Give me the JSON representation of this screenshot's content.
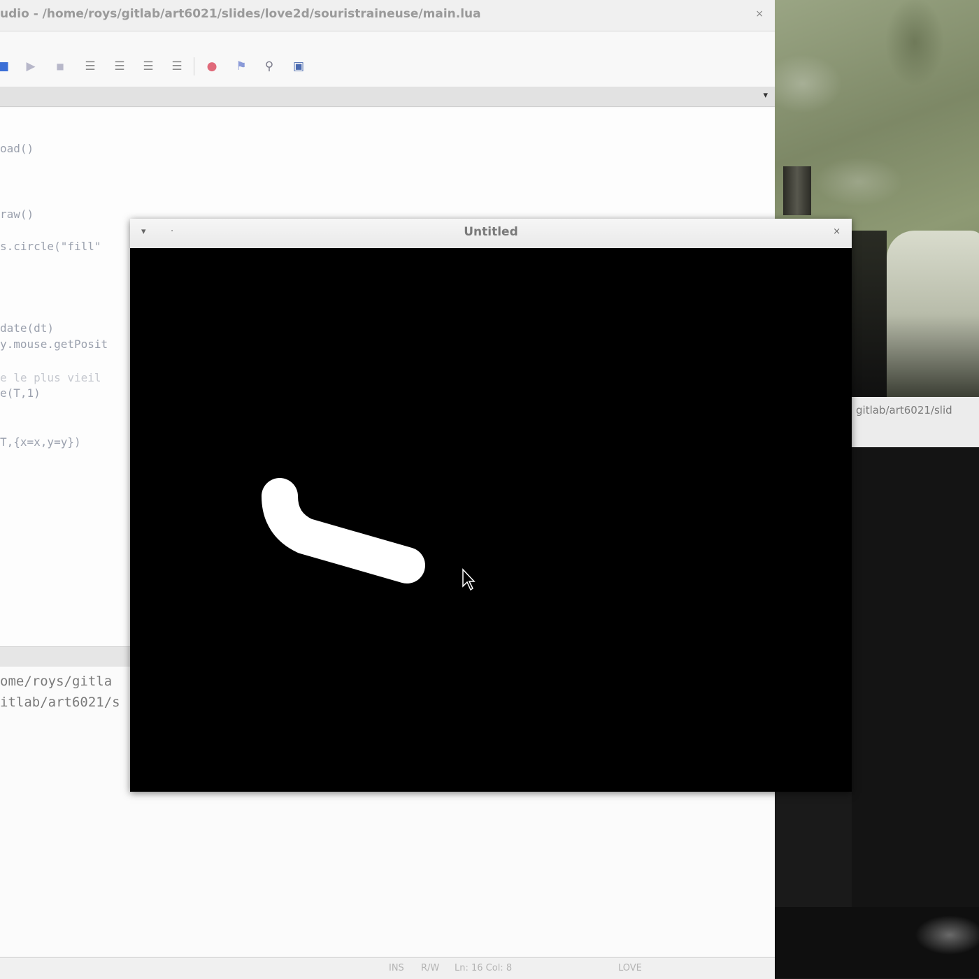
{
  "editor": {
    "title": "udio - /home/roys/gitlab/art6021/slides/love2d/souristraineuse/main.lua",
    "close_glyph": "×",
    "toolbar": {
      "icons": [
        "save-icon",
        "run-icon",
        "stop-icon",
        "indent-icon",
        "outdent-icon",
        "align-icon",
        "list-icon",
        "breakpoint-icon",
        "bookmark-icon",
        "watch-icon",
        "stack-icon"
      ],
      "glyphs": [
        "■",
        "▶",
        "■",
        "☰",
        "☰",
        "☰",
        "☰",
        "●",
        "⚑",
        "⚲",
        "▣"
      ]
    },
    "tab_arrow": "▾",
    "code_lines": [
      "oad()",
      "raw()",
      "s.circle(\"fill\"",
      "date(dt)",
      "y.mouse.getPosit",
      "e le plus vieil",
      "e(T,1)",
      "T,{x=x,y=y})"
    ],
    "output_lines": [
      "ome/roys/gitla",
      "itlab/art6021/s"
    ],
    "status": {
      "ins": "INS",
      "rw": "R/W",
      "position": "Ln: 16 Col: 8",
      "interpreter": "LOVE"
    }
  },
  "love_window": {
    "title": "Untitled",
    "left_glyph": "▾",
    "dot_glyph": "·",
    "close_glyph": "×"
  },
  "terminal": {
    "title": "gitlab/art6021/slid"
  },
  "colors": {
    "stroke": "#ffffff",
    "canvas": "#000000"
  }
}
